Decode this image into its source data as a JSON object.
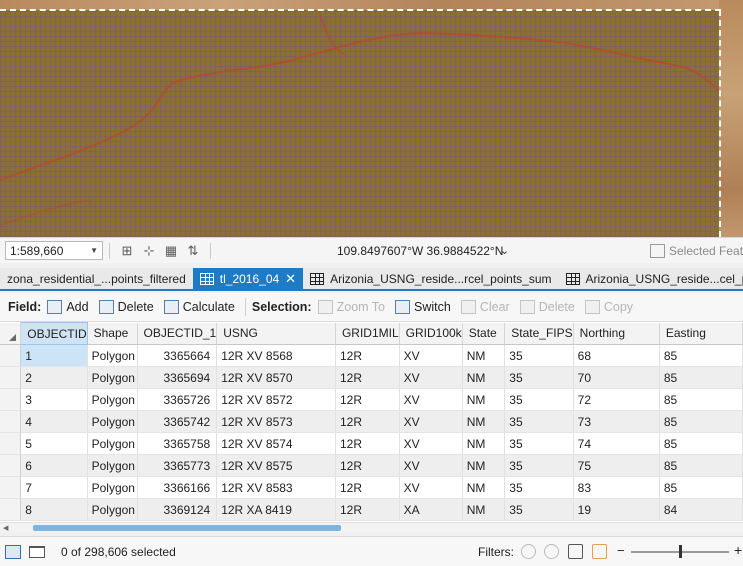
{
  "map_status": {
    "scale": "1:589,660",
    "coordinates": "109.8497607°W 36.9884522°N",
    "selected_features_label": "Selected Featu"
  },
  "tabs": [
    {
      "label": "zona_residential_...points_filtered",
      "active": false,
      "icon": false
    },
    {
      "label": "tl_2016_04",
      "active": true,
      "icon": true
    },
    {
      "label": "Arizonia_USNG_reside...rcel_points_sum",
      "active": false,
      "icon": true
    },
    {
      "label": "Arizonia_USNG_reside...cel_po",
      "active": false,
      "icon": true
    }
  ],
  "toolbar": {
    "field_label": "Field:",
    "add": "Add",
    "delete": "Delete",
    "calculate": "Calculate",
    "selection_label": "Selection:",
    "zoom_to": "Zoom To",
    "switch": "Switch",
    "clear": "Clear",
    "delete_sel": "Delete",
    "copy": "Copy"
  },
  "table": {
    "columns": [
      "OBJECTID",
      "Shape",
      "OBJECTID_1",
      "USNG",
      "GRID1MIL",
      "GRID100k",
      "State",
      "State_FIPS",
      "Northing",
      "Easting"
    ],
    "rows": [
      [
        "1",
        "Polygon",
        "3365664",
        "12R XV 8568",
        "12R",
        "XV",
        "NM",
        "35",
        "68",
        "85"
      ],
      [
        "2",
        "Polygon",
        "3365694",
        "12R XV 8570",
        "12R",
        "XV",
        "NM",
        "35",
        "70",
        "85"
      ],
      [
        "3",
        "Polygon",
        "3365726",
        "12R XV 8572",
        "12R",
        "XV",
        "NM",
        "35",
        "72",
        "85"
      ],
      [
        "4",
        "Polygon",
        "3365742",
        "12R XV 8573",
        "12R",
        "XV",
        "NM",
        "35",
        "73",
        "85"
      ],
      [
        "5",
        "Polygon",
        "3365758",
        "12R XV 8574",
        "12R",
        "XV",
        "NM",
        "35",
        "74",
        "85"
      ],
      [
        "6",
        "Polygon",
        "3365773",
        "12R XV 8575",
        "12R",
        "XV",
        "NM",
        "35",
        "75",
        "85"
      ],
      [
        "7",
        "Polygon",
        "3366166",
        "12R XV 8583",
        "12R",
        "XV",
        "NM",
        "35",
        "83",
        "85"
      ],
      [
        "8",
        "Polygon",
        "3369124",
        "12R XA 8419",
        "12R",
        "XA",
        "NM",
        "35",
        "19",
        "84"
      ]
    ]
  },
  "footer": {
    "selected_text": "0 of 298,606 selected",
    "filters_label": "Filters:"
  },
  "colors": {
    "accent": "#1e7cc7",
    "map_fill": "#8a7130",
    "grid_line": "#78508c"
  }
}
